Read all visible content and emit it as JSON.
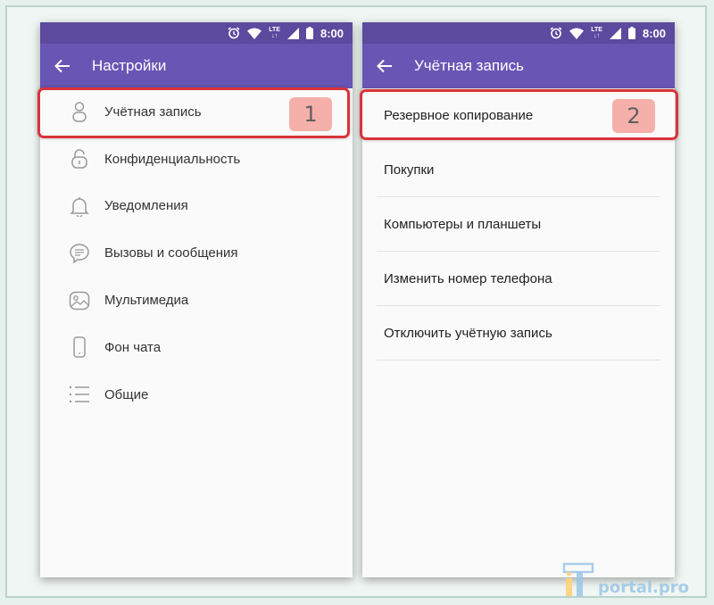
{
  "status_bar": {
    "time": "8:00",
    "network": "LTE"
  },
  "left_screen": {
    "title": "Настройки",
    "items": [
      {
        "label": "Учётная запись",
        "icon": "person-icon"
      },
      {
        "label": "Конфиденциальность",
        "icon": "lock-icon"
      },
      {
        "label": "Уведомления",
        "icon": "bell-icon"
      },
      {
        "label": "Вызовы и сообщения",
        "icon": "chat-bubble-icon"
      },
      {
        "label": "Мультимедиа",
        "icon": "image-icon"
      },
      {
        "label": "Фон чата",
        "icon": "phone-icon"
      },
      {
        "label": "Общие",
        "icon": "list-icon"
      }
    ],
    "step_badge": "1"
  },
  "right_screen": {
    "title": "Учётная запись",
    "items": [
      {
        "label": "Резервное копирование"
      },
      {
        "label": "Покупки"
      },
      {
        "label": "Компьютеры и планшеты"
      },
      {
        "label": "Изменить номер телефона"
      },
      {
        "label": "Отключить учётную запись"
      }
    ],
    "step_badge": "2"
  },
  "watermark": {
    "text": "portal.pro"
  },
  "colors": {
    "status_bar": "#5b4a9e",
    "toolbar": "#6856b5",
    "highlight_border": "#d9333b",
    "badge_fill": "#f5b0aa",
    "icon": "#9a9a9a"
  }
}
